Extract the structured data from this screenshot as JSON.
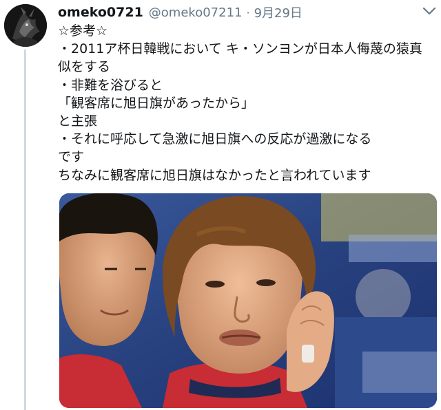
{
  "tweet": {
    "display_name": "omeko0721",
    "handle": "@omeko07211",
    "separator": "·",
    "date": "9月29日",
    "menu_icon": "chevron-down-icon",
    "avatar_icon": "dark-creature-avatar",
    "lines": [
      "☆参考☆",
      "・2011ア杯日韓戦において キ・ソンヨンが日本人侮蔑の猿真",
      "似をする",
      "・非難を浴びると",
      "「観客席に旭日旗があったから」",
      "と主張",
      "・それに呼応して急激に旭日旗への反応が過激になる",
      "です",
      "ちなみに観客席に旭日旗はなかったと言われています"
    ],
    "media_description": "photo"
  },
  "colors": {
    "text": "#14171a",
    "secondary": "#657786",
    "thread_line": "#cfd9de"
  }
}
